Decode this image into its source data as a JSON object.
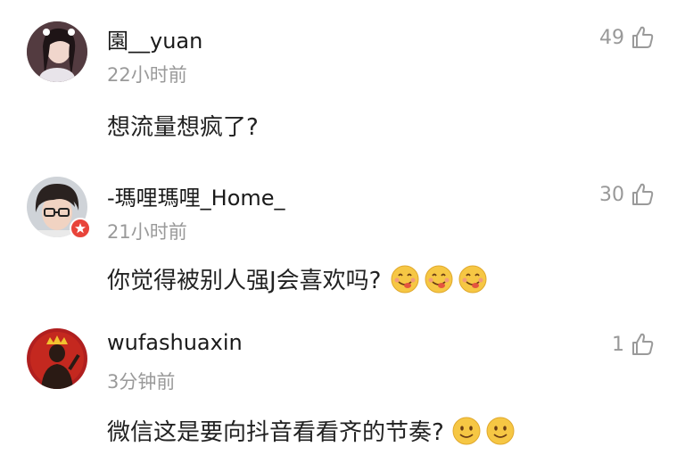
{
  "comments": [
    {
      "username": "園__yuan",
      "time": "22小时前",
      "text": "想流量想疯了?",
      "likes": "49",
      "avatar_icon": "avatar-girl-photo",
      "emoji": []
    },
    {
      "username": "-瑪哩瑪哩_Home_",
      "time": "21小时前",
      "text": "你觉得被别人强J会喜欢吗?",
      "likes": "30",
      "avatar_icon": "avatar-boy-glasses-photo",
      "badge": "verified-star-badge",
      "emoji": [
        "yum-face-emoji",
        "yum-face-emoji",
        "yum-face-emoji"
      ]
    },
    {
      "username": "wufashuaxin",
      "time": "3分钟前",
      "text": "微信这是要向抖音看看齐的节奏?",
      "likes": "1",
      "avatar_icon": "avatar-king-silhouette",
      "emoji": [
        "smile-face-emoji",
        "smile-face-emoji"
      ]
    }
  ],
  "colors": {
    "text": "#222222",
    "meta": "#9a9a9a",
    "badge": "#e8443a",
    "emoji": "#f6c744"
  }
}
